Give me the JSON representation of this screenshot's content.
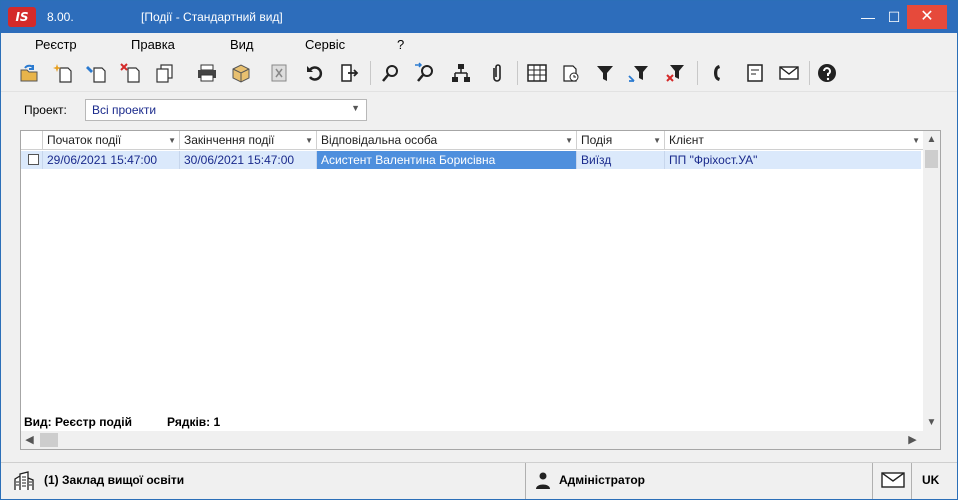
{
  "window": {
    "version": "8.00.",
    "title": "[Події - Стандартний вид]",
    "minimize": "—",
    "maximize": "☐",
    "close": "✕"
  },
  "menu": [
    "Реєстр",
    "Правка",
    "Вид",
    "Сервіс",
    "?"
  ],
  "toolbar": {
    "icons": [
      "refresh-folder-icon",
      "new-document-icon",
      "edit-document-icon",
      "delete-document-icon",
      "copy-icon",
      "print-icon",
      "package-icon",
      "export-icon",
      "undo-icon",
      "exit-icon",
      "search-icon",
      "search-next-icon",
      "hierarchy-icon",
      "attachment-icon",
      "table-icon",
      "calendar-icon",
      "filter-icon",
      "filter-edit-icon",
      "filter-clear-icon",
      "phone-icon",
      "note-icon",
      "mail-icon",
      "help-icon"
    ]
  },
  "filter": {
    "label": "Проект:",
    "value": "Всі проекти"
  },
  "grid": {
    "columns": [
      "Початок події",
      "Закінчення події",
      "Відповідальна особа",
      "Подія",
      "Клієнт"
    ],
    "rows": [
      {
        "start": "29/06/2021 15:47:00",
        "end": "30/06/2021 15:47:00",
        "person": "Асистент Валентина Борисівна",
        "event": "Виїзд",
        "client": "ПП \"Фріхост.УА\""
      }
    ],
    "footer_view": "Вид: Реєстр подій",
    "footer_rows": "Рядків: 1"
  },
  "status": {
    "organization": "(1) Заклад вищої освіти",
    "user": "Адміністратор",
    "language": "UK"
  }
}
